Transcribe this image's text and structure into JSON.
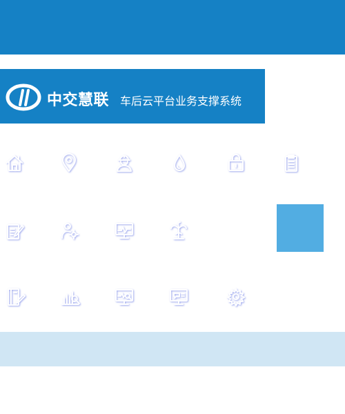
{
  "header": {
    "company_name": "中交慧联",
    "system_name": "车后云平台业务支撑系统"
  },
  "colors": {
    "primary": "#1581c5",
    "accent_tile": "#52ade2",
    "band": "#d0e6f4",
    "icon_stroke": "#ffffff",
    "icon_shadow": "#5a6bdc"
  },
  "icon_rows": [
    [
      "home-icon",
      "location-pin-icon",
      "worker-icon",
      "water-drop-icon",
      "lock-icon",
      "clipboard-icon"
    ],
    [
      "edit-document-icon",
      "person-settings-icon",
      "monitor-chart-icon",
      "tree-icon"
    ],
    [
      "book-edit-icon",
      "bar-chart-search-icon",
      "monitor-search-icon",
      "monitor-chat-icon",
      "gear-icon"
    ]
  ]
}
